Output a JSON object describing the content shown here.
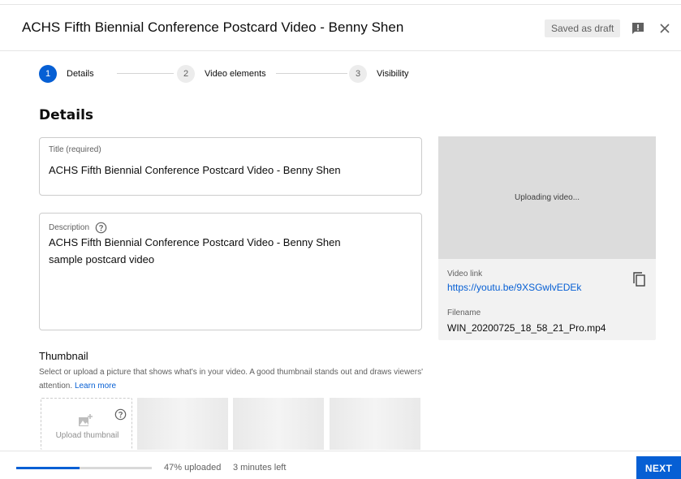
{
  "header": {
    "title": "ACHS Fifth Biennial Conference Postcard Video - Benny Shen",
    "draft_status": "Saved as draft",
    "feedback_icon": "feedback-icon",
    "close_icon": "close-icon"
  },
  "stepper": {
    "steps": [
      {
        "number": "1",
        "label": "Details",
        "active": true
      },
      {
        "number": "2",
        "label": "Video elements",
        "active": false
      },
      {
        "number": "3",
        "label": "Visibility",
        "active": false
      }
    ]
  },
  "details": {
    "section_title": "Details",
    "title_field": {
      "label": "Title (required)",
      "value": "ACHS Fifth Biennial Conference Postcard Video - Benny Shen"
    },
    "description_field": {
      "label": "Description",
      "value": "ACHS Fifth Biennial Conference Postcard Video - Benny Shen\nsample postcard video"
    }
  },
  "preview": {
    "status": "Uploading video...",
    "link_label": "Video link",
    "link": "https://youtu.be/9XSGwlvEDEk",
    "filename_label": "Filename",
    "filename": "WIN_20200725_18_58_21_Pro.mp4"
  },
  "thumbnail": {
    "title": "Thumbnail",
    "description": "Select or upload a picture that shows what's in your video. A good thumbnail stands out and draws viewers' attention.",
    "learn_more": "Learn more",
    "upload_label": "Upload thumbnail"
  },
  "footer": {
    "progress_percent": 47,
    "progress_text": "47% uploaded",
    "time_left": "3 minutes left",
    "next_label": "NEXT"
  },
  "colors": {
    "accent": "#065fd4",
    "muted_text": "#606060"
  }
}
